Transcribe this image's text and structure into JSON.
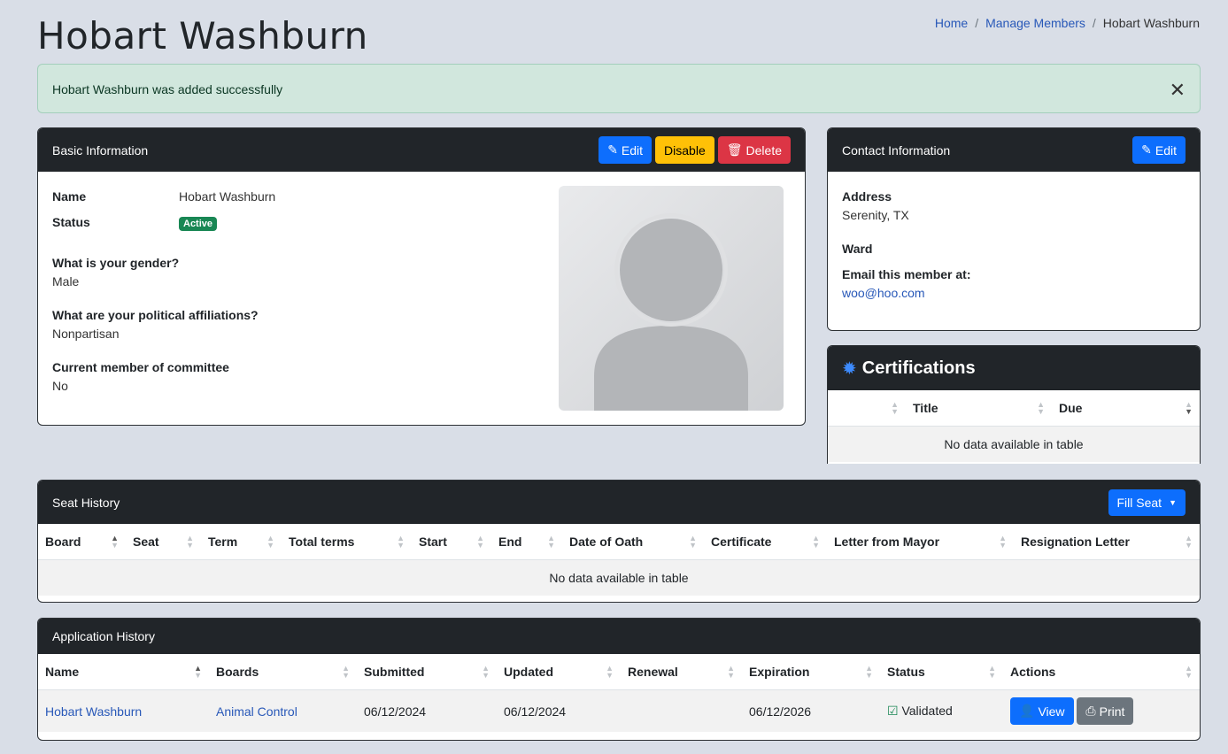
{
  "page": {
    "title": "Hobart Washburn"
  },
  "breadcrumb": {
    "home": "Home",
    "manage": "Manage Members",
    "current": "Hobart Washburn"
  },
  "alert": {
    "message": "Hobart Washburn was added successfully",
    "close": "✕"
  },
  "basic": {
    "header": "Basic Information",
    "edit": "Edit",
    "disable": "Disable",
    "delete": "Delete",
    "name_label": "Name",
    "name_value": "Hobart Washburn",
    "status_label": "Status",
    "status_value": "Active",
    "gender_label": "What is your gender?",
    "gender_value": "Male",
    "political_label": "What are your political affiliations?",
    "political_value": "Nonpartisan",
    "committee_label": "Current member of committee",
    "committee_value": "No"
  },
  "contact": {
    "header": "Contact Information",
    "edit": "Edit",
    "address_label": "Address",
    "address_value": "Serenity, TX",
    "ward_label": "Ward",
    "email_label": "Email this member at:",
    "email_value": "woo@hoo.com"
  },
  "certifications": {
    "header": "Certifications",
    "columns": [
      "Title",
      "Due"
    ],
    "empty": "No data available in table"
  },
  "seat_history": {
    "header": "Seat History",
    "fill_seat": "Fill Seat",
    "columns": [
      "Board",
      "Seat",
      "Term",
      "Total terms",
      "Start",
      "End",
      "Date of Oath",
      "Certificate",
      "Letter from Mayor",
      "Resignation Letter"
    ],
    "empty": "No data available in table"
  },
  "application_history": {
    "header": "Application History",
    "columns": [
      "Name",
      "Boards",
      "Submitted",
      "Updated",
      "Renewal",
      "Expiration",
      "Status",
      "Actions"
    ],
    "rows": [
      {
        "name": "Hobart Washburn",
        "boards": "Animal Control",
        "submitted": "06/12/2024",
        "updated": "06/12/2024",
        "renewal": "",
        "expiration": "06/12/2026",
        "status": "Validated",
        "view": "View",
        "print": "Print"
      }
    ]
  },
  "colors": {
    "primary": "#0d6efd",
    "warning": "#ffc107",
    "danger": "#dc3545",
    "success": "#198754",
    "header": "#212529",
    "page_bg": "#d9dee7"
  }
}
